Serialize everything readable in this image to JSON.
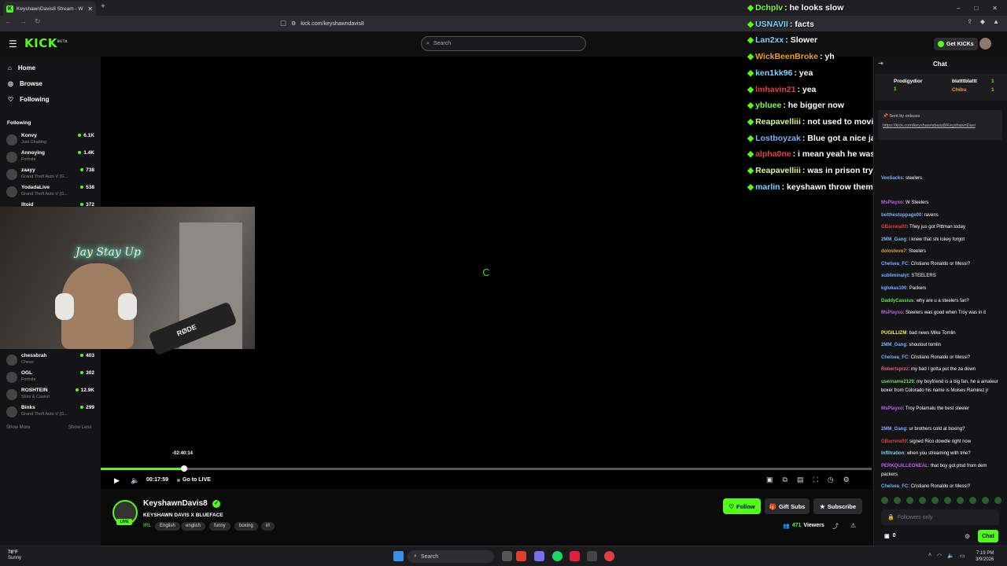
{
  "browser": {
    "tab_title": "KeyshawnDavis8 Stream - W",
    "tab_favicon": "K",
    "new_tab": "+",
    "url": "kick.com/keyshawndavis8",
    "window_buttons": [
      "–",
      "□",
      "✕"
    ]
  },
  "header": {
    "logo": "KICK",
    "logo_sup": "BETA",
    "search_placeholder": "Search",
    "get_kicks": "Get KICKs"
  },
  "sidebar": {
    "nav": [
      {
        "label": "Home",
        "icon": "home-icon"
      },
      {
        "label": "Browse",
        "icon": "compass-icon"
      },
      {
        "label": "Following",
        "icon": "heart-icon"
      }
    ],
    "following_title": "Following",
    "channels_top": [
      {
        "name": "Konvy",
        "game": "Just Chatting",
        "viewers": "6.1K"
      },
      {
        "name": "Annoying",
        "game": "Fortnite",
        "viewers": "1.4K"
      },
      {
        "name": "zaayy",
        "game": "Grand Theft Auto V (G...",
        "viewers": "738"
      },
      {
        "name": "YodadaLive",
        "game": "Grand Theft Auto V (G...",
        "viewers": "538"
      },
      {
        "name": "lltoid",
        "game": "",
        "viewers": "372"
      }
    ],
    "channels_bottom": [
      {
        "name": "chessbrah",
        "game": "Chess",
        "viewers": "403"
      },
      {
        "name": "OGL",
        "game": "Fortnite",
        "viewers": "302"
      },
      {
        "name": "ROSHTEIN",
        "game": "Slots & Casino",
        "viewers": "12.9K"
      },
      {
        "name": "Binks",
        "game": "Grand Theft Auto V (G...",
        "viewers": "299"
      }
    ],
    "show_more": "Show More",
    "show_less": "Show Less"
  },
  "stream_overlay_chat": [
    {
      "user": "Dchplv",
      "color": "#7CFC4A",
      "text": "he looks slow"
    },
    {
      "user": "USNAVII",
      "color": "#7CD4FF",
      "text": "facts"
    },
    {
      "user": "Lan2xx",
      "color": "#7CD4FF",
      "text": "Slower"
    },
    {
      "user": "WickBeenBroke",
      "color": "#F0A030",
      "text": "yh"
    },
    {
      "user": "ken1kk96",
      "color": "#7CD4FF",
      "text": "yea"
    },
    {
      "user": "lmhavin21",
      "color": "#E04040",
      "text": "yea"
    },
    {
      "user": "ybluee",
      "color": "#7CFC4A",
      "text": "he bigger now"
    },
    {
      "user": "Reapavelliii",
      "color": "#D8F890",
      "text": "not used to movie his weight around"
    },
    {
      "user": "Lostboyzak",
      "color": "#7CAEFF",
      "text": "Blue got a nice jab but doesn't lead with it at all"
    },
    {
      "user": "alpha0ne",
      "color": "#E04040",
      "text": "i mean yeah he was def quicker when skinnier"
    },
    {
      "user": "Reapavelliii",
      "color": "#D8F890",
      "text": "was in prison tryna knock niggas"
    },
    {
      "user": "marlin",
      "color": "#7CD4FF",
      "text": "keyshawn throw them hard shits man"
    }
  ],
  "player": {
    "time_tooltip": "-02:40:14",
    "current_time": "00:17:59",
    "go_live": "Go to LIVE",
    "progress_fraction": 0.108
  },
  "stream": {
    "streamer": "KeyshawnDavis8",
    "live_badge": "LIVE",
    "title": "KEYSHAWN DAVIS X BLUEFACE",
    "category": "IRL",
    "tags": [
      "English",
      "english",
      "funny",
      "boxing",
      "irl"
    ],
    "follow": "Follow",
    "gift_subs": "Gift Subs",
    "subscribe": "Subscribe",
    "viewers": "471",
    "viewers_label": "Viewers"
  },
  "chat": {
    "title": "Chat",
    "leaderboard": [
      {
        "name": "Prodigydior",
        "count": "1"
      },
      {
        "name": "blatttblattt",
        "count": "1"
      },
      {
        "name": "Chibu",
        "count": "1"
      }
    ],
    "pinned_sender_label": "Sent by",
    "pinned_sender": "onlsuxs",
    "pinned_link": "https://kick.com/keyshawndavis8/KeyshawnDavi",
    "messages": [
      {
        "user": "VeeSacks",
        "color": "#7CAEFF",
        "text": "steelers"
      },
      {
        "user": "MsPlayxo",
        "color": "#C060F0",
        "text": "W Steelers"
      },
      {
        "user": "betthestoppage00",
        "color": "#7CAEFF",
        "text": "ravens"
      },
      {
        "user": "GBarrera00",
        "color": "#E04040",
        "text": "They jus got Pittman today"
      },
      {
        "user": "2MM_Gang",
        "color": "#7CAEFF",
        "text": "i knew that shi lokey forgot"
      },
      {
        "user": "dolostevo7",
        "color": "#E0A030",
        "text": "Steelers"
      },
      {
        "user": "Chelsea_FC",
        "color": "#7CAEFF",
        "text": "Cristiano Ronaldo or Messi?"
      },
      {
        "user": "subliminalyt",
        "color": "#7CAEFF",
        "text": "STEELERS"
      },
      {
        "user": "kglukas100",
        "color": "#7CAEFF",
        "text": "Packers"
      },
      {
        "user": "DaddyCassius",
        "color": "#60E060",
        "text": "why are u a steelers fan?"
      },
      {
        "user": "MsPlayxo",
        "color": "#C060F0",
        "text": "Steelers was good when Troy was in it"
      },
      {
        "user": "PUGILLIZM",
        "color": "#F0F060",
        "text": "bad news Mike Tomlin"
      },
      {
        "user": "2MM_Gang",
        "color": "#7CAEFF",
        "text": "shoutout tomlin"
      },
      {
        "user": "Chelsea_FC",
        "color": "#7CAEFF",
        "text": "Cristiano Ronaldo or Messi?"
      },
      {
        "user": "Robertsprzz",
        "color": "#E06080",
        "text": "my bad I gotta put the za down"
      },
      {
        "user": "username2129",
        "color": "#60E060",
        "text": "my boyfriend is a big fan, he a amateur boxer from Colorado his name is Moises Ramirez jr"
      },
      {
        "user": "MsPlayxo",
        "color": "#C060F0",
        "text": "Troy Polamalu the best steeler"
      },
      {
        "user": "2MM_Gang",
        "color": "#7CAEFF",
        "text": "ur brothers cold at boxing?"
      },
      {
        "user": "GBarrera00",
        "color": "#E04040",
        "text": "signed Rico dowdle right now"
      },
      {
        "user": "Infiltration",
        "color": "#7CD4FF",
        "text": "when you streaming with tme?"
      },
      {
        "user": "PERKQUILLEONEAL",
        "color": "#C060F0",
        "text": "that boy got ptsd from dem packers"
      },
      {
        "user": "Chelsea_FC",
        "color": "#7CAEFF",
        "text": "Cristiano Ronaldo or Messi?"
      }
    ],
    "input_placeholder": "Followers only",
    "kicks_count": "0",
    "send": "Chat"
  },
  "taskbar": {
    "temp": "78°F",
    "weather": "Sunny",
    "search": "Search",
    "time": "7:19 PM",
    "date": "3/9/2026"
  },
  "colors": {
    "accent": "#53fc18"
  }
}
